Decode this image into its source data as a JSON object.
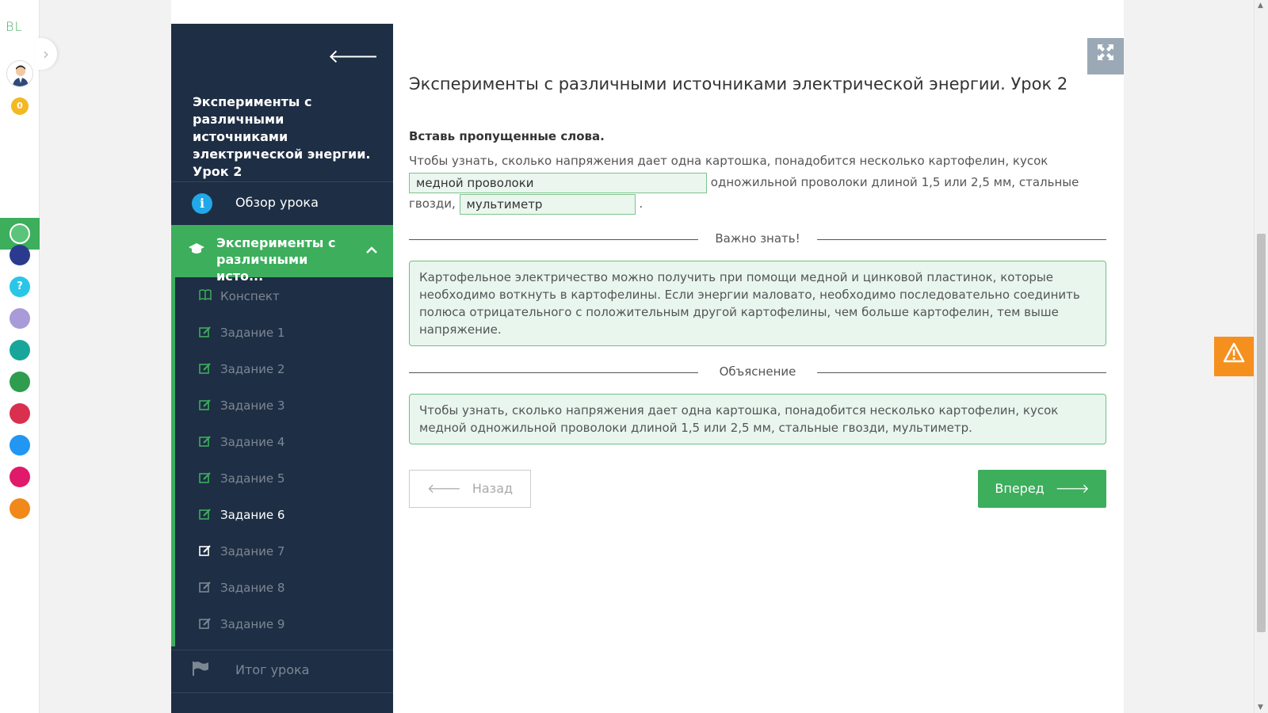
{
  "rail": {
    "logo": "BL",
    "coins": "0",
    "apps": [
      {
        "name": "online-mektep",
        "color": "#3cae5c",
        "active": true
      },
      {
        "name": "smart-nation",
        "color": "#2a3b8f"
      },
      {
        "name": "help",
        "color": "#29c6e8"
      },
      {
        "name": "keyboard",
        "color": "#a99ad8"
      },
      {
        "name": "bilim-class",
        "color": "#19a69a"
      },
      {
        "name": "bilim-land",
        "color": "#2e9d4f"
      },
      {
        "name": "bilim-shop",
        "color": "#d9304f"
      },
      {
        "name": "tasks",
        "color": "#2196f3"
      },
      {
        "name": "twig",
        "color": "#e0196b"
      },
      {
        "name": "bilimkitap",
        "color": "#f0891a"
      }
    ]
  },
  "sidebar": {
    "title": "Эксперименты с различными источниками электрической энергии. Урок 2",
    "overview_label": "Обзор урока",
    "lesson_label": "Эксперименты с различными исто...",
    "items": [
      {
        "label": "Конспект",
        "icon": "book-icon"
      },
      {
        "label": "Задание 1",
        "icon": "edit-icon"
      },
      {
        "label": "Задание 2",
        "icon": "edit-icon"
      },
      {
        "label": "Задание 3",
        "icon": "edit-icon"
      },
      {
        "label": "Задание 4",
        "icon": "edit-icon"
      },
      {
        "label": "Задание 5",
        "icon": "edit-icon"
      },
      {
        "label": "Задание 6",
        "icon": "edit-icon"
      },
      {
        "label": "Задание 7",
        "icon": "edit-icon"
      },
      {
        "label": "Задание 8",
        "icon": "edit-icon"
      },
      {
        "label": "Задание 9",
        "icon": "edit-icon"
      }
    ],
    "summary_label": "Итог урока"
  },
  "content": {
    "title": "Эксперименты с различными источниками электрической энергии. Урок 2",
    "instruction": "Вставь пропущенные слова.",
    "sentence_part1": "Чтобы узнать, сколько напряжения дает одна картошка, понадобится несколько картофелин, кусок",
    "blank1": "медной проволоки",
    "sentence_part2": "одножильной проволоки длиной 1,5 или 2,5 мм, стальные гвозди,",
    "blank2": "мультиметр",
    "sentence_part3": ".",
    "important_heading": "Важно знать!",
    "important_text": "Картофельное электричество можно получить при помощи медной и цинковой пластинок, которые необходимо воткнуть в картофелины. Если энергии маловато, необходимо последовательно соединить полюса отрицательного с положительным другой картофелины, чем больше картофелин, тем выше напряжение.",
    "explanation_heading": "Объяснение",
    "explanation_text": "Чтобы узнать, сколько напряжения дает одна картошка, понадобится несколько картофелин, кусок медной одножильной проволоки длиной 1,5 или 2,5 мм, стальные гвозди, мультиметр.",
    "back_label": "Назад",
    "next_label": "Вперед"
  },
  "colors": {
    "accent": "#3cae5c",
    "sidebar_bg": "#1e2e44",
    "warning": "#f5901f"
  }
}
